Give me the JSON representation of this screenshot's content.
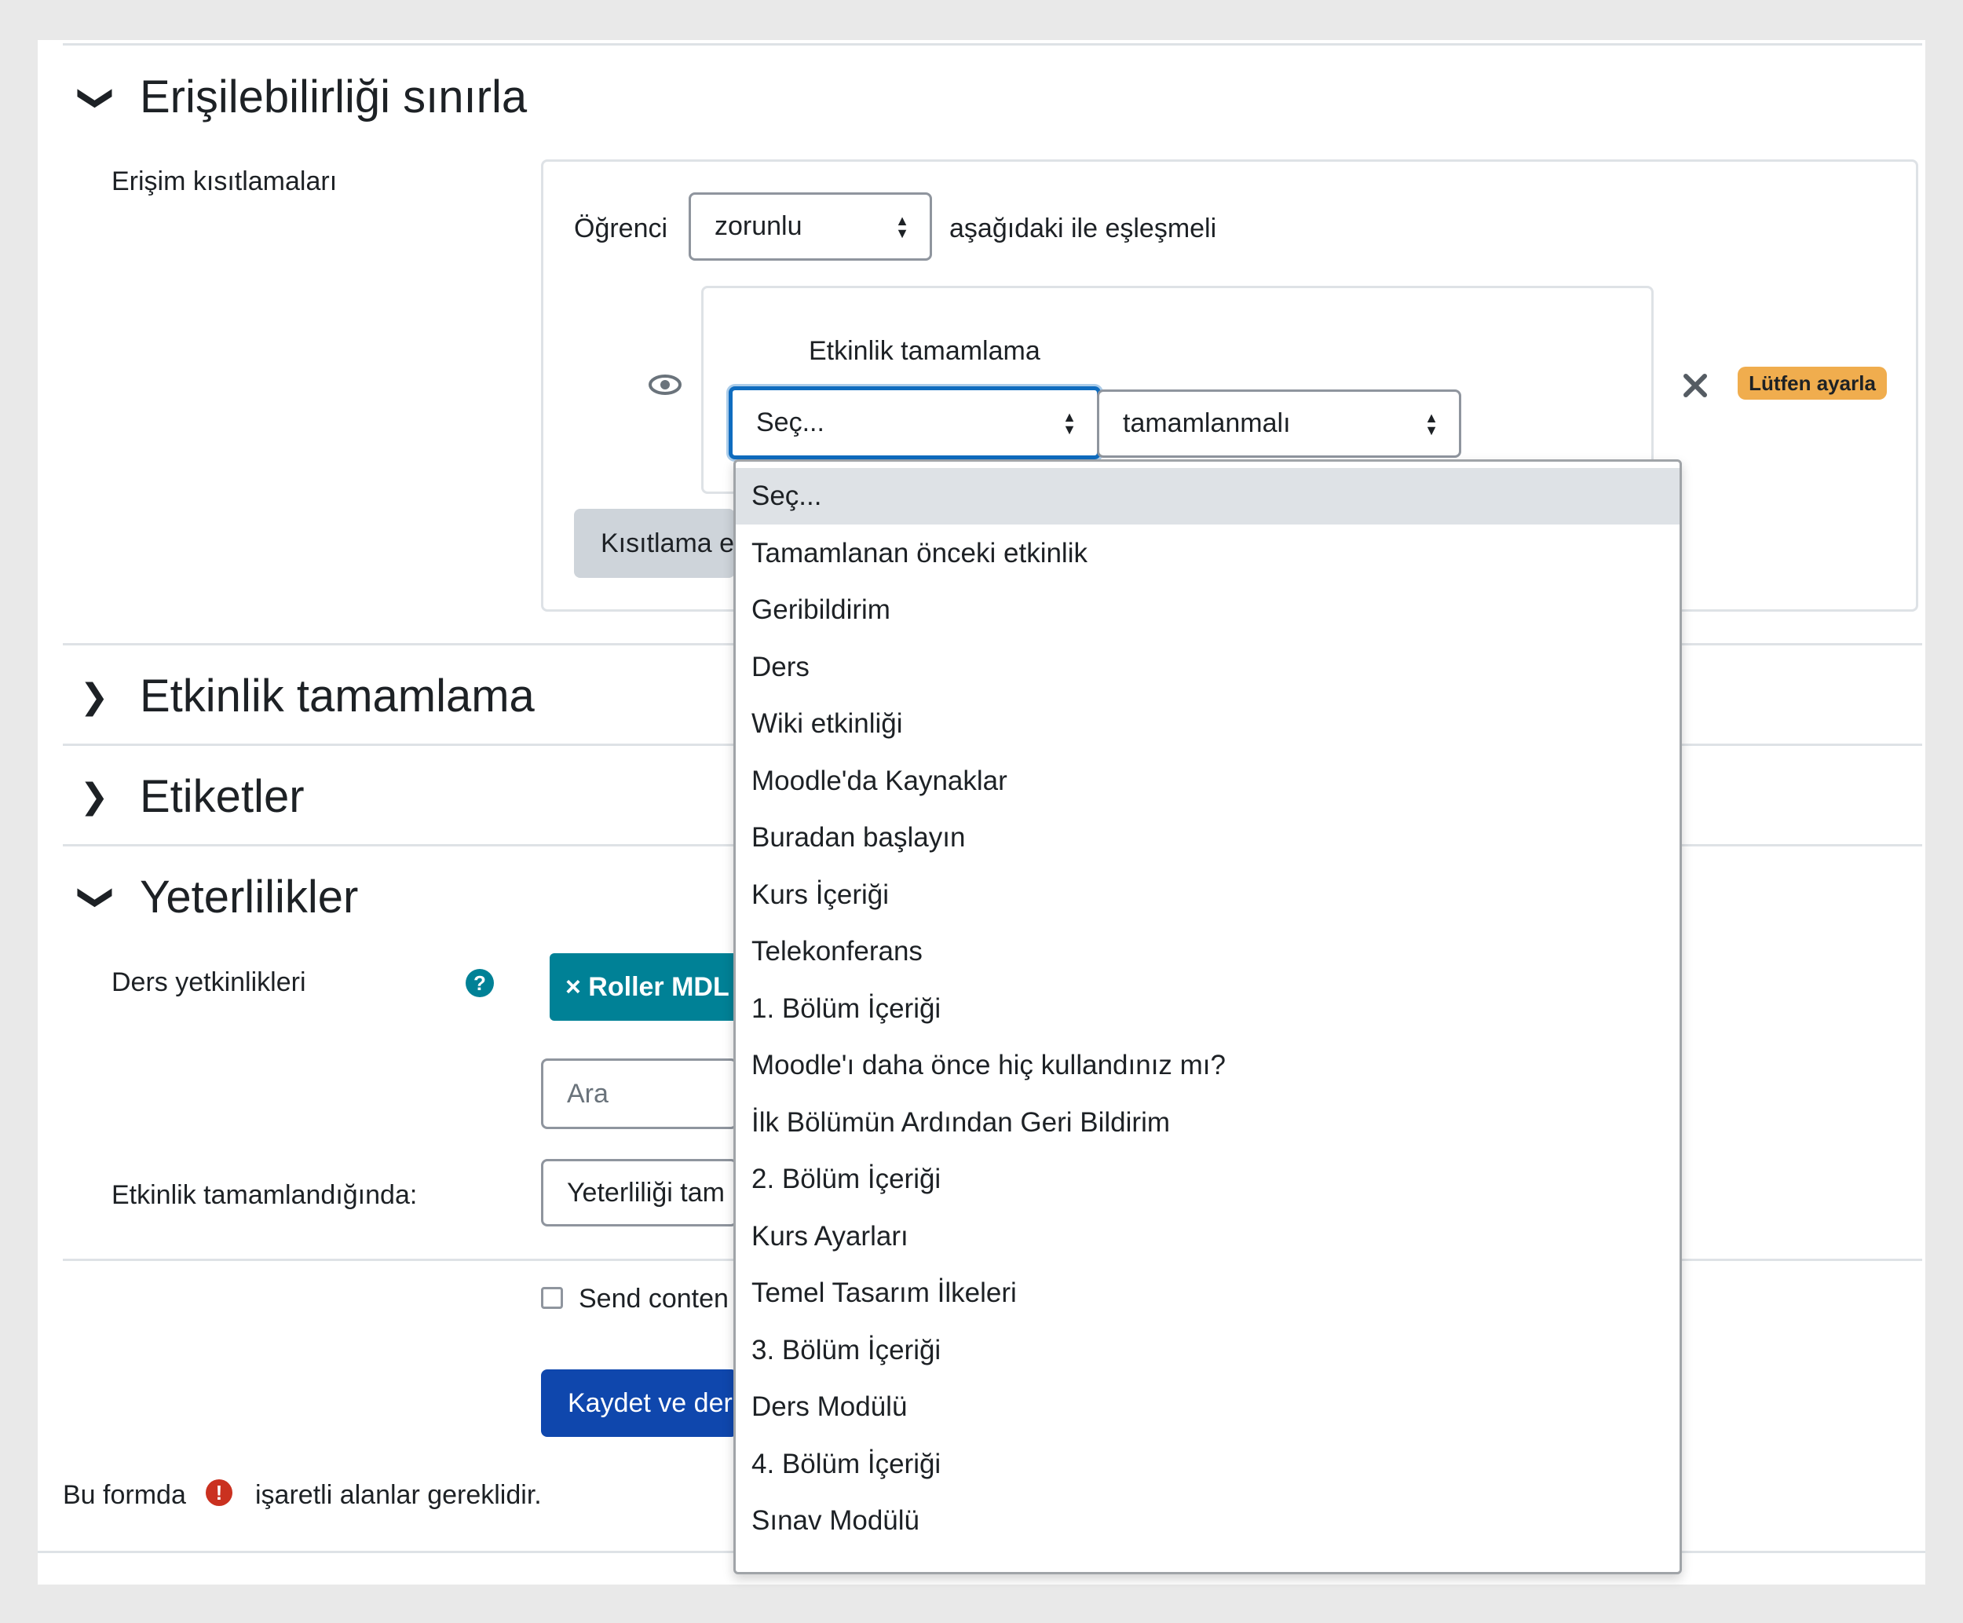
{
  "sections": {
    "restrict": {
      "title": "Erişilebilirliği sınırla",
      "state": "expanded"
    },
    "completion": {
      "title": "Etkinlik tamamlama",
      "state": "collapsed"
    },
    "tags": {
      "title": "Etiketler",
      "state": "collapsed"
    },
    "competencies": {
      "title": "Yeterlilikler",
      "state": "expanded"
    }
  },
  "restrict": {
    "label": "Erişim kısıtlamaları",
    "student_label": "Öğrenci",
    "must_select": {
      "value": "zorunlu"
    },
    "match_label": "aşağıdaki ile eşleşmeli",
    "condition": {
      "title": "Etkinlik tamamlama",
      "activity_select": {
        "value": "Seç..."
      },
      "state_select": {
        "value": "tamamlanmalı"
      },
      "eye_icon": "eye-icon",
      "delete_icon": "close-icon",
      "warning_badge": "Lütfen ayarla"
    },
    "add_button": "Kısıtlama e"
  },
  "dropdown": {
    "options": [
      "Seç...",
      "Tamamlanan önceki etkinlik",
      "Geribildirim",
      "Ders",
      "Wiki etkinliği",
      "Moodle'da Kaynaklar",
      "Buradan başlayın",
      "Kurs İçeriği",
      "Telekonferans",
      "1. Bölüm İçeriği",
      "Moodle'ı daha önce hiç kullandınız mı?",
      "İlk Bölümün Ardından Geri Bildirim",
      "2. Bölüm İçeriği",
      "Kurs Ayarları",
      "Temel Tasarım İlkeleri",
      "3. Bölüm İçeriği",
      "Ders Modülü",
      "4. Bölüm İçeriği",
      "Sınav Modülü"
    ],
    "selected_index": 0
  },
  "competencies": {
    "course_label": "Ders yetkinlikleri",
    "help_icon": "question-circle-icon",
    "tag": "× Roller MDL",
    "search_placeholder": "Ara",
    "on_complete_label": "Etkinlik tamamlandığında:",
    "on_complete_value": "Yeterliliği tam"
  },
  "footer": {
    "send_content": "Send conten",
    "save_button": "Kaydet ve der",
    "required_prefix": "Bu formda",
    "required_suffix": "işaretli alanlar gereklidir.",
    "required_icon": "exclamation-circle-icon"
  },
  "colors": {
    "primary": "#0f47ad",
    "focus": "#0f6cbf",
    "tag": "#008196",
    "warning": "#f0ad4e",
    "danger": "#ca3120"
  }
}
